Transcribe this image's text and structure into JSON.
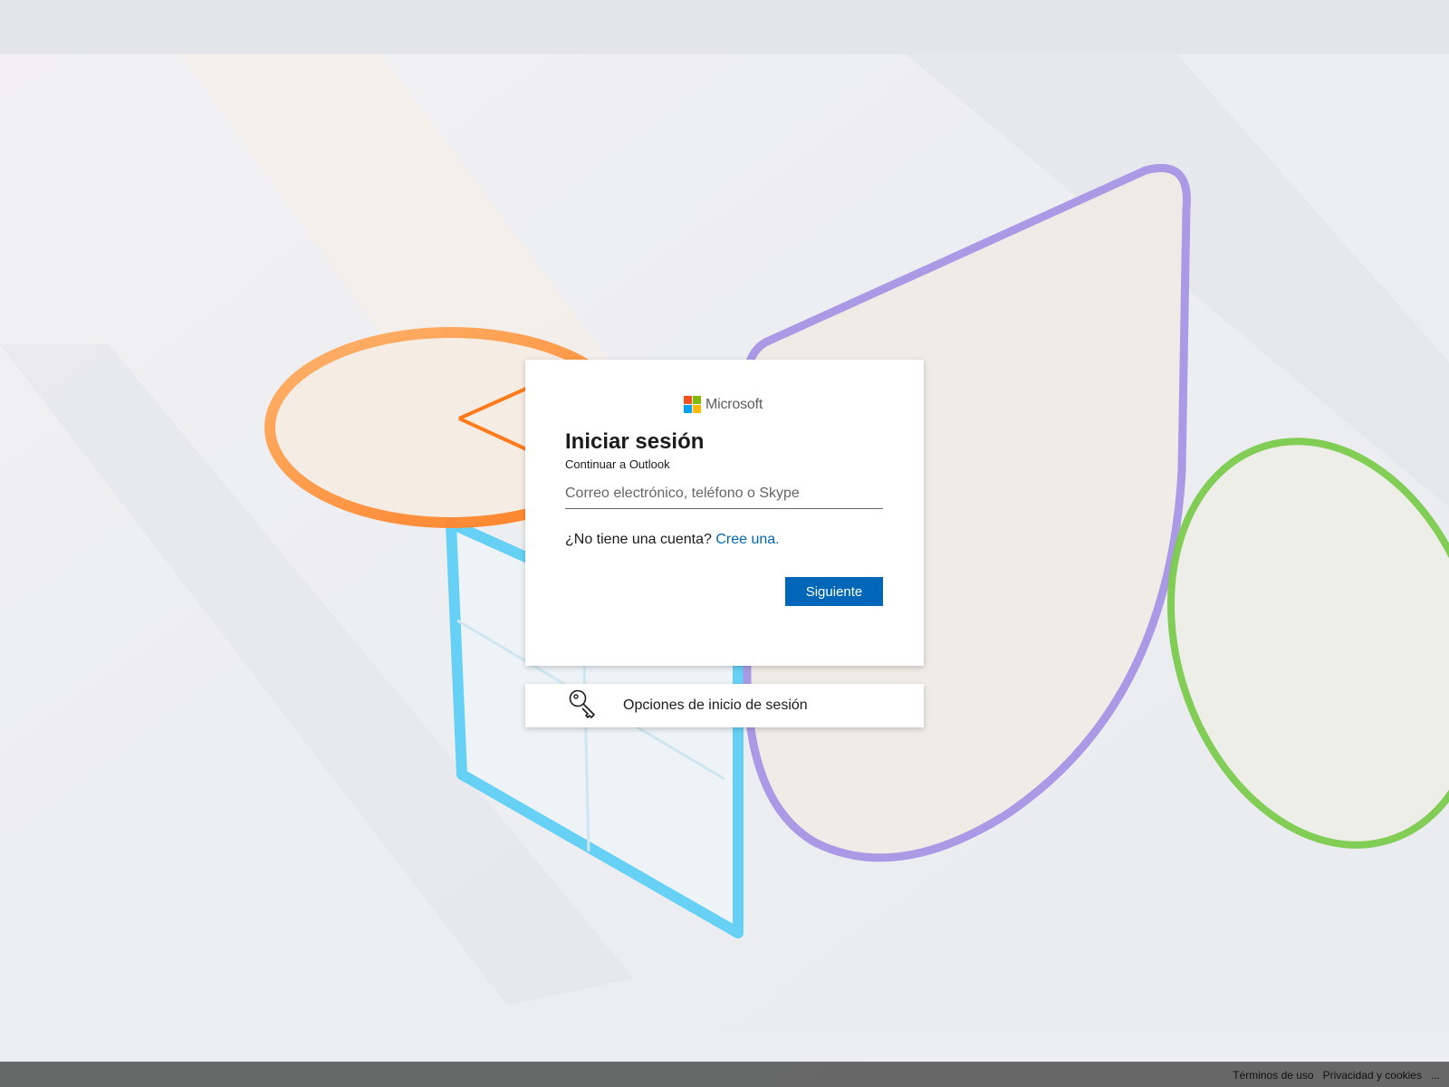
{
  "logo": {
    "name": "Microsoft",
    "colors": [
      "#f25022",
      "#7fba00",
      "#00a4ef",
      "#ffb900"
    ]
  },
  "signin": {
    "title": "Iniciar sesión",
    "subtitle": "Continuar a Outlook",
    "email_placeholder": "Correo electrónico, teléfono o Skype",
    "email_value": "",
    "no_account_text": "¿No tiene una cuenta?",
    "create_link": "Cree una.",
    "next_label": "Siguiente"
  },
  "options": {
    "label": "Opciones de inicio de sesión",
    "icon": "key-icon"
  },
  "footer": {
    "terms": "Términos de uso",
    "privacy": "Privacidad y cookies",
    "more": "..."
  },
  "colors": {
    "accent": "#0067b8",
    "text": "#1b1b1b"
  }
}
